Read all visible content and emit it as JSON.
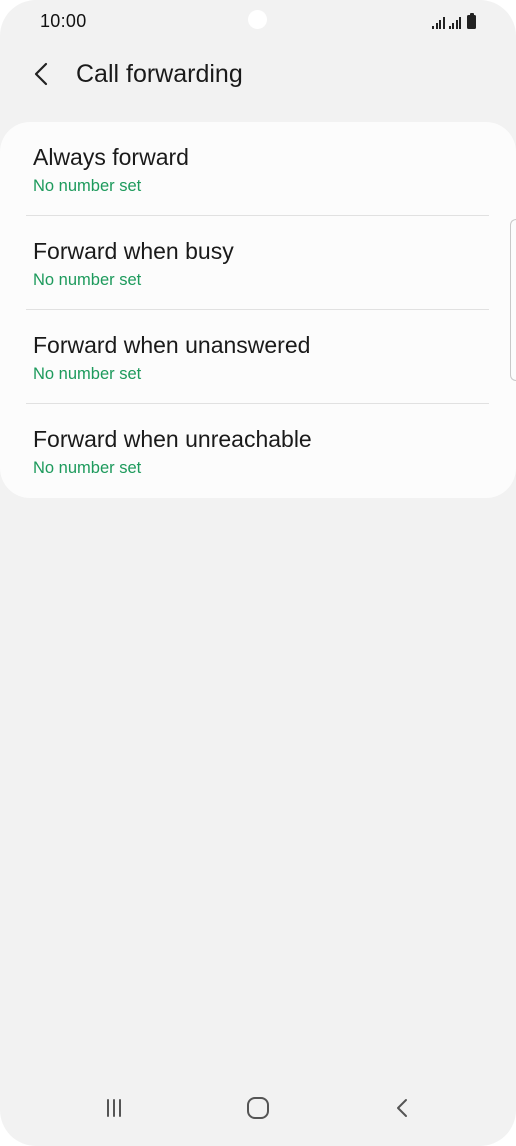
{
  "status_bar": {
    "time": "10:00"
  },
  "app_bar": {
    "title": "Call forwarding",
    "back_icon": "chevron-left-icon"
  },
  "forwarding_options": [
    {
      "title": "Always forward",
      "subtitle": "No number set"
    },
    {
      "title": "Forward when busy",
      "subtitle": "No number set"
    },
    {
      "title": "Forward when unanswered",
      "subtitle": "No number set"
    },
    {
      "title": "Forward when unreachable",
      "subtitle": "No number set"
    }
  ],
  "navigation_bar": {
    "icons": [
      "recent-apps-icon",
      "home-icon",
      "back-icon"
    ]
  },
  "colors": {
    "background": "#f2f2f2",
    "card": "#fcfcfc",
    "accent_green": "#1d9a5c",
    "text_primary": "#1a1a1a"
  }
}
